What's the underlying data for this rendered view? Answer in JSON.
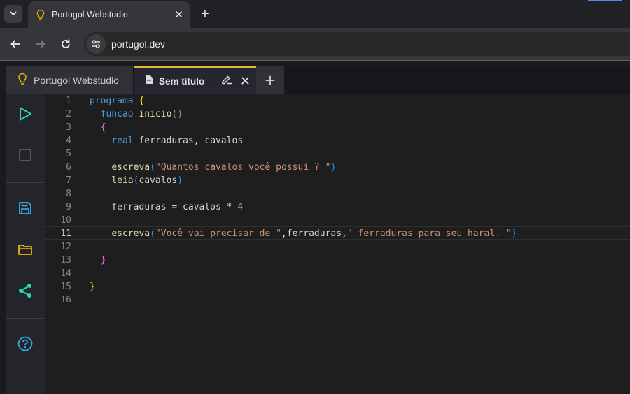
{
  "browser": {
    "tab_title": "Portugol Webstudio",
    "url": "portugol.dev",
    "new_tab": "+",
    "close": "✕",
    "tab_menu": "⌄"
  },
  "app": {
    "tabs": [
      {
        "label": "Portugol Webstudio",
        "icon": "lightbulb-icon"
      },
      {
        "label": "Sem título",
        "icon": "file-icon",
        "active": true
      }
    ],
    "add_tab": "+",
    "close": "✕",
    "sidebar": [
      "run-icon",
      "stop-icon",
      "save-icon",
      "open-folder-icon",
      "share-icon",
      "help-icon"
    ]
  },
  "editor": {
    "active_line": 11,
    "lines": [
      {
        "n": "1",
        "tokens": [
          [
            "kw",
            "programa"
          ],
          [
            "p",
            " "
          ],
          [
            "b1",
            "{"
          ]
        ]
      },
      {
        "n": "2",
        "tokens": [
          [
            "p",
            "  "
          ],
          [
            "kw",
            "funcao"
          ],
          [
            "p",
            " "
          ],
          [
            "fn",
            "inicio"
          ],
          [
            "b2",
            "()"
          ]
        ]
      },
      {
        "n": "3",
        "tokens": [
          [
            "p",
            "  "
          ],
          [
            "b2",
            "{"
          ]
        ]
      },
      {
        "n": "4",
        "tokens": [
          [
            "p",
            "    "
          ],
          [
            "kw",
            "real"
          ],
          [
            "p",
            " ferraduras, cavalos"
          ]
        ]
      },
      {
        "n": "5",
        "tokens": []
      },
      {
        "n": "6",
        "tokens": [
          [
            "p",
            "    "
          ],
          [
            "fn",
            "escreva"
          ],
          [
            "b3",
            "("
          ],
          [
            "str",
            "\"Quantos cavalos você possui ? \""
          ],
          [
            "b3",
            ")"
          ]
        ]
      },
      {
        "n": "7",
        "tokens": [
          [
            "p",
            "    "
          ],
          [
            "fn",
            "leia"
          ],
          [
            "b3",
            "("
          ],
          [
            "p",
            "cavalos"
          ],
          [
            "b3",
            ")"
          ]
        ]
      },
      {
        "n": "8",
        "tokens": []
      },
      {
        "n": "9",
        "tokens": [
          [
            "p",
            "    ferraduras = cavalos * "
          ],
          [
            "num",
            "4"
          ]
        ]
      },
      {
        "n": "10",
        "tokens": []
      },
      {
        "n": "11",
        "tokens": [
          [
            "p",
            "    "
          ],
          [
            "fn",
            "escreva"
          ],
          [
            "b3",
            "("
          ],
          [
            "str",
            "\"Você vai precisar de \""
          ],
          [
            "p",
            ",ferraduras,"
          ],
          [
            "str",
            "\" ferraduras para seu haral. \""
          ],
          [
            "b3",
            ")"
          ]
        ]
      },
      {
        "n": "12",
        "tokens": []
      },
      {
        "n": "13",
        "tokens": [
          [
            "p",
            "  "
          ],
          [
            "b2",
            "}"
          ]
        ]
      },
      {
        "n": "14",
        "tokens": []
      },
      {
        "n": "15",
        "tokens": [
          [
            "b1",
            "}"
          ]
        ]
      },
      {
        "n": "16",
        "tokens": []
      }
    ]
  },
  "colors": {
    "accent_tab": "#e5b83a",
    "run": "#2bd9b4",
    "sidebar_icons": "#3aa9e8",
    "folder": "#f0b400"
  }
}
